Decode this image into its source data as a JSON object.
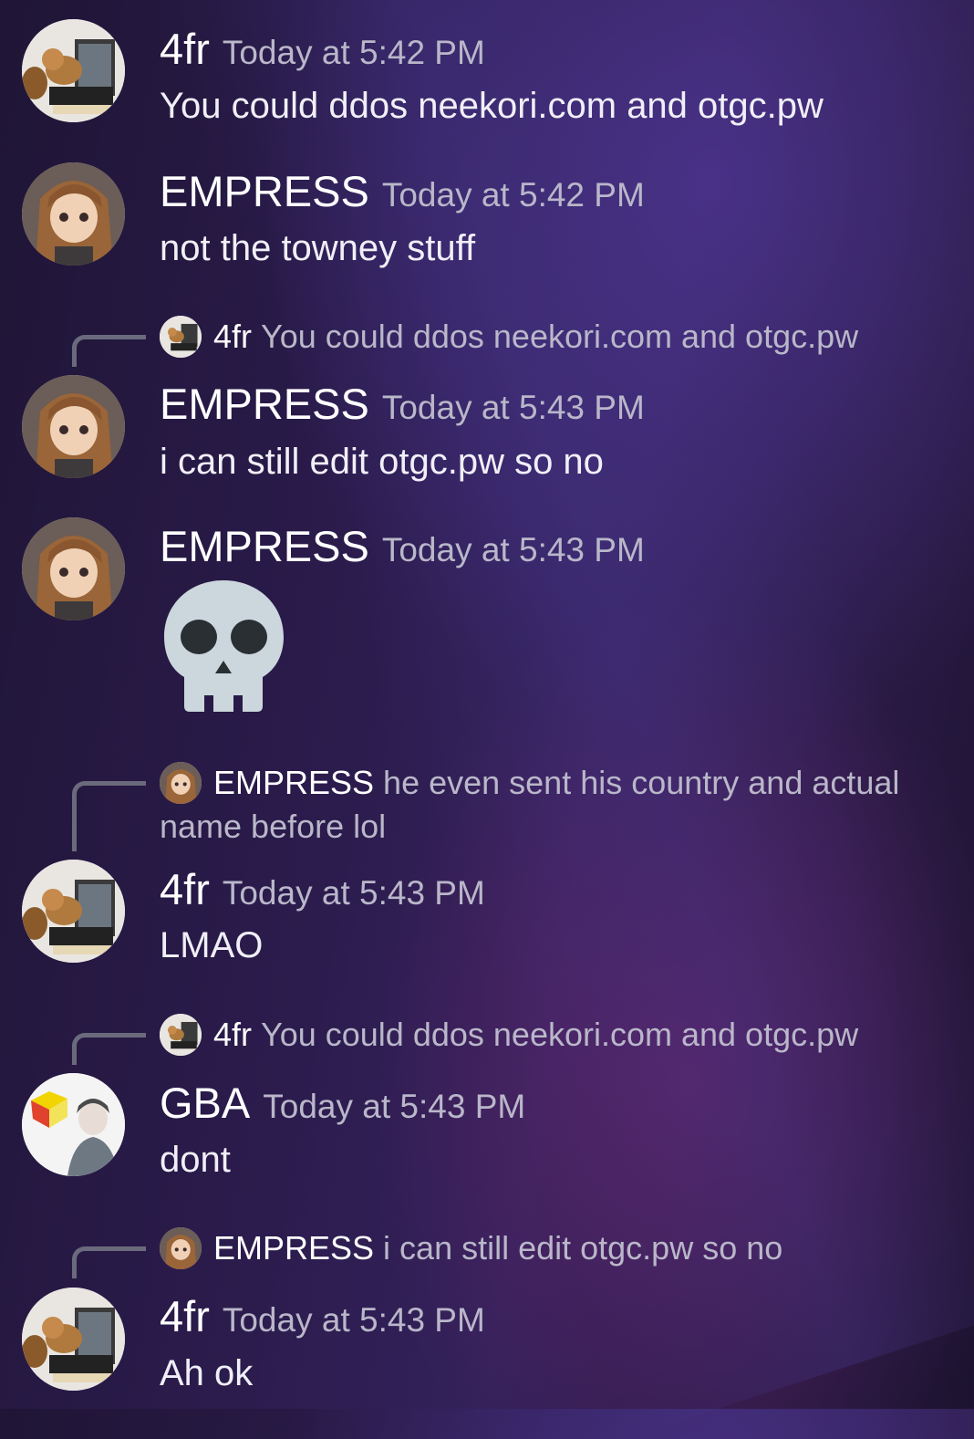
{
  "messages": [
    {
      "author": "4fr",
      "time": "Today at 5:42 PM",
      "text": "You could ddos neekori.com and otgc.pw"
    },
    {
      "author": "EMPRESS",
      "time": "Today at 5:42 PM",
      "text": "not the towney stuff"
    },
    {
      "reply": {
        "author": "4fr",
        "text": "You could ddos neekori.com and otgc.pw"
      },
      "author": "EMPRESS",
      "time": "Today at 5:43 PM",
      "text": "i can still edit otgc.pw so no"
    },
    {
      "author": "EMPRESS",
      "time": "Today at 5:43 PM",
      "emoji": "skull-emoji"
    },
    {
      "reply": {
        "author": "EMPRESS",
        "text": "he even sent his country and actual name before lol"
      },
      "author": "4fr",
      "time": "Today at 5:43 PM",
      "text": "LMAO"
    },
    {
      "reply": {
        "author": "4fr",
        "text": "You could ddos neekori.com and otgc.pw"
      },
      "author": "GBA",
      "time": "Today at 5:43 PM",
      "text": "dont"
    },
    {
      "reply": {
        "author": "EMPRESS",
        "text": "i can still edit otgc.pw so no"
      },
      "author": "4fr",
      "time": "Today at 5:43 PM",
      "text": "Ah ok"
    }
  ],
  "colors": {
    "username": "#ffffff",
    "timestamp": "#b9b7c9",
    "reply_text": "#b9b7c9",
    "reply_line": "#6b6a7d"
  }
}
